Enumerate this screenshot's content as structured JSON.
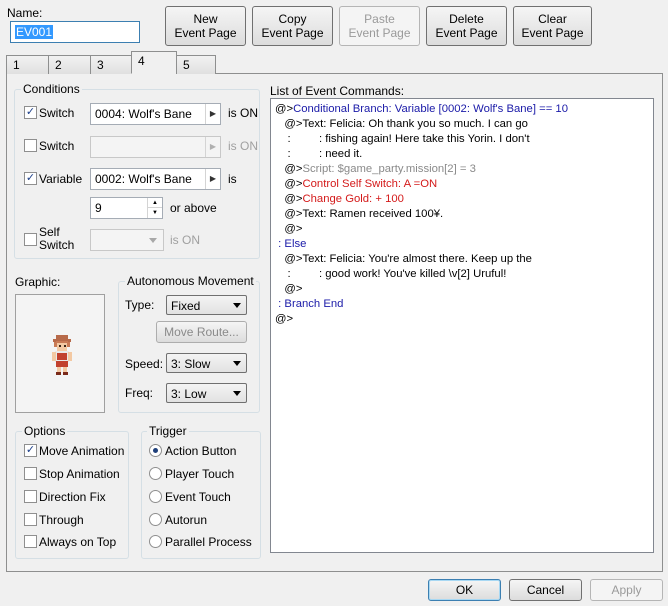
{
  "name_label": "Name:",
  "name_value": "EV001",
  "top_buttons": {
    "new": [
      "New",
      "Event Page"
    ],
    "copy": [
      "Copy",
      "Event Page"
    ],
    "paste": [
      "Paste",
      "Event Page"
    ],
    "delete": [
      "Delete",
      "Event Page"
    ],
    "clear": [
      "Clear",
      "Event Page"
    ]
  },
  "tabs": [
    "1",
    "2",
    "3",
    "4",
    "5"
  ],
  "active_tab": "4",
  "conditions": {
    "title": "Conditions",
    "switch1": {
      "label": "Switch",
      "value": "0004: Wolf's Bane",
      "suffix": "is ON",
      "checked": true
    },
    "switch2": {
      "label": "Switch",
      "value": "",
      "suffix": "is ON",
      "checked": false
    },
    "variable": {
      "label": "Variable",
      "value": "0002: Wolf's Bane",
      "suffix": "is",
      "checked": true,
      "amount": "9",
      "amount_suffix": "or above"
    },
    "self_switch": {
      "label_line1": "Self",
      "label_line2": "Switch",
      "value": "",
      "suffix": "is ON",
      "checked": false
    }
  },
  "graphic_label": "Graphic:",
  "autonomous": {
    "title": "Autonomous Movement",
    "type_label": "Type:",
    "type_value": "Fixed",
    "move_route": "Move Route...",
    "speed_label": "Speed:",
    "speed_value": "3: Slow",
    "freq_label": "Freq:",
    "freq_value": "3: Low"
  },
  "options": {
    "title": "Options",
    "items": [
      {
        "label": "Move Animation",
        "checked": true
      },
      {
        "label": "Stop Animation",
        "checked": false
      },
      {
        "label": "Direction Fix",
        "checked": false
      },
      {
        "label": "Through",
        "checked": false
      },
      {
        "label": "Always on Top",
        "checked": false
      }
    ]
  },
  "trigger": {
    "title": "Trigger",
    "items": [
      {
        "label": "Action Button",
        "selected": true
      },
      {
        "label": "Player Touch",
        "selected": false
      },
      {
        "label": "Event Touch",
        "selected": false
      },
      {
        "label": "Autorun",
        "selected": false
      },
      {
        "label": "Parallel Process",
        "selected": false
      }
    ]
  },
  "commands_label": "List of Event Commands:",
  "commands": [
    {
      "prefix": "@>",
      "text": "Conditional Branch: Variable [0002: Wolf's Bane] == 10",
      "color": "#1a1aa8"
    },
    {
      "prefix": "   @>",
      "text": "Text: Felicia: Oh thank you so much. I can go",
      "color": "#000000"
    },
    {
      "prefix": "    :",
      "text": "         : fishing again! Here take this Yorin. I don't",
      "color": "#000000"
    },
    {
      "prefix": "    :",
      "text": "         : need it.",
      "color": "#000000"
    },
    {
      "prefix": "   @>",
      "text": "Script: $game_party.mission[2] = 3",
      "color": "#8a8a8a"
    },
    {
      "prefix": "   @>",
      "text": "Control Self Switch: A =ON",
      "color": "#d41a1a"
    },
    {
      "prefix": "   @>",
      "text": "Change Gold: + 100",
      "color": "#d41a1a"
    },
    {
      "prefix": "   @>",
      "text": "Text: Ramen received 100¥.",
      "color": "#000000"
    },
    {
      "prefix": "   @>",
      "text": "",
      "color": "#000000"
    },
    {
      "prefix": " : ",
      "text": "Else",
      "color": "#1a1aa8"
    },
    {
      "prefix": "   @>",
      "text": "Text: Felicia: You're almost there. Keep up the",
      "color": "#000000"
    },
    {
      "prefix": "    :",
      "text": "         : good work! You've killed \\v[2] Uruful!",
      "color": "#000000"
    },
    {
      "prefix": "   @>",
      "text": "",
      "color": "#000000"
    },
    {
      "prefix": " : ",
      "text": "Branch End",
      "color": "#1a1aa8"
    },
    {
      "prefix": "@>",
      "text": "",
      "color": "#000000"
    }
  ],
  "bottom_buttons": {
    "ok": "OK",
    "cancel": "Cancel",
    "apply": "Apply"
  }
}
